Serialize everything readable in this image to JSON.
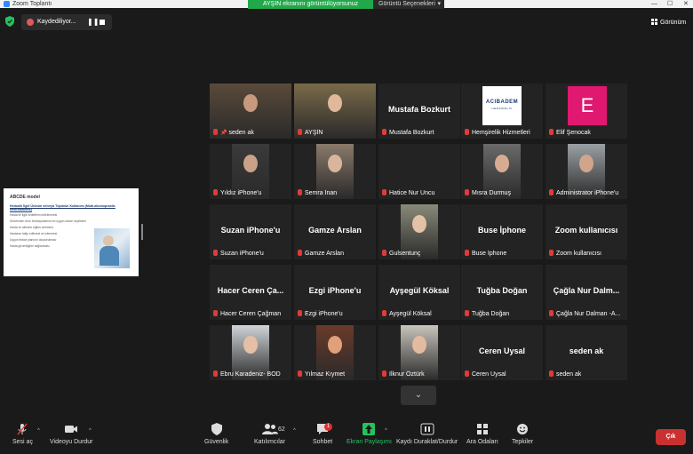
{
  "window": {
    "title": "Zoom Toplantı",
    "controls": [
      "—",
      "☐",
      "✕"
    ]
  },
  "sharing": {
    "banner": "AYŞİN ekranını görüntülüyorsunuz",
    "view_options": "Görüntü Seçenekleri",
    "view_options_caret": "▾"
  },
  "recording": {
    "label": "Kaydediliyor...",
    "pause": "❚❚"
  },
  "view_button": {
    "label": "Görünüm"
  },
  "slide": {
    "title": "ABCDE model",
    "heading": "Hedonik İlgili Ürünün ve/veya Tüpünün Kullanımı (Multi-allomoprastic environments)",
    "lines": [
      "Hasta ile ilgili hedeflerin belirlenmesi",
      "Ürünlerden ürün fonksiyonlarına en uygun olanın seçilmesi",
      "Hasta ve ailesine eğitim verilmesi",
      "Hastanın takip edilmesi ve izlenmesi",
      "Uygun tedavi planının oluşturulması",
      "Hasta güvenliğinin sağlanması"
    ]
  },
  "tiles": [
    {
      "name": "seden ak",
      "pinned": true,
      "video": true
    },
    {
      "name": "AYŞİN",
      "video": true,
      "active": true
    },
    {
      "name": "Mustafa Bozkurt",
      "display": "Mustafa Bozkurt"
    },
    {
      "name": "Hemşirelik Hizmetleri",
      "logo": "ACIBADEM",
      "logo_sub": "HEMŞİRELİK"
    },
    {
      "name": "Elif Şenocak",
      "avatar_letter": "E",
      "avatar_color": "#e0186f"
    },
    {
      "name": "Yıldız iPhone'u",
      "video": true
    },
    {
      "name": "Semra İnan",
      "video": true
    },
    {
      "name": "Hatice Nur Uncu"
    },
    {
      "name": "Mısra Durmuş",
      "video": true
    },
    {
      "name": "Administrator iPhone'u",
      "video": true
    },
    {
      "name": "Suzan iPhone'u",
      "display": "Suzan iPhone'u"
    },
    {
      "name": "Gamze Arslan",
      "display": "Gamze Arslan"
    },
    {
      "name": "Gulsentunç",
      "video": true
    },
    {
      "name": "Buse İphone",
      "display": "Buse İphone"
    },
    {
      "name": "Zoom kullanıcısı",
      "display": "Zoom kullanıcısı"
    },
    {
      "name": "Hacer Ceren Çağman",
      "display": "Hacer Ceren Ça..."
    },
    {
      "name": "Ezgi iPhone'u",
      "display": "Ezgi iPhone'u"
    },
    {
      "name": "Ayşegül Köksal",
      "display": "Ayşegül Köksal"
    },
    {
      "name": "Tuğba Doğan",
      "display": "Tuğba Doğan"
    },
    {
      "name": "Çağla Nur Dalman -A...",
      "display": "Çağla Nur Dalm..."
    },
    {
      "name": "Ebru Karadeniz- BOD",
      "video": true
    },
    {
      "name": "Yılmaz Kıymet",
      "video": true
    },
    {
      "name": "İlknur Öztürk",
      "video": true
    },
    {
      "name": "Ceren Uysal",
      "display": "Ceren Uysal"
    },
    {
      "name": "seden ak",
      "display": "seden ak"
    }
  ],
  "more_button": {
    "label": "⌄"
  },
  "toolbar": {
    "audio": {
      "label": "Sesi aç",
      "icon": "microphone-muted-icon"
    },
    "video": {
      "label": "Videoyu Durdur",
      "icon": "video-camera-icon"
    },
    "security": {
      "label": "Güvenlik",
      "icon": "shield-icon"
    },
    "participants": {
      "label": "Katılımcılar",
      "count": "62",
      "icon": "participants-icon"
    },
    "chat": {
      "label": "Sohbet",
      "badge": "1",
      "icon": "chat-bubble-icon"
    },
    "share": {
      "label": "Ekran Paylaşımı",
      "icon": "share-up-arrow-icon"
    },
    "pause_record": {
      "label": "Kaydı Duraklat/Durdur",
      "icon": "pause-icon"
    },
    "rooms": {
      "label": "Ara Odaları",
      "icon": "grid-icon"
    },
    "reactions": {
      "label": "Tepkiler",
      "icon": "smiley-icon"
    },
    "leave": {
      "label": "Çık"
    },
    "caret": "^"
  },
  "colors": {
    "share_green": "#22a84a",
    "active_speaker": "#e8d43b",
    "leave_red": "#c93131",
    "mic_red": "#e03b3b"
  }
}
